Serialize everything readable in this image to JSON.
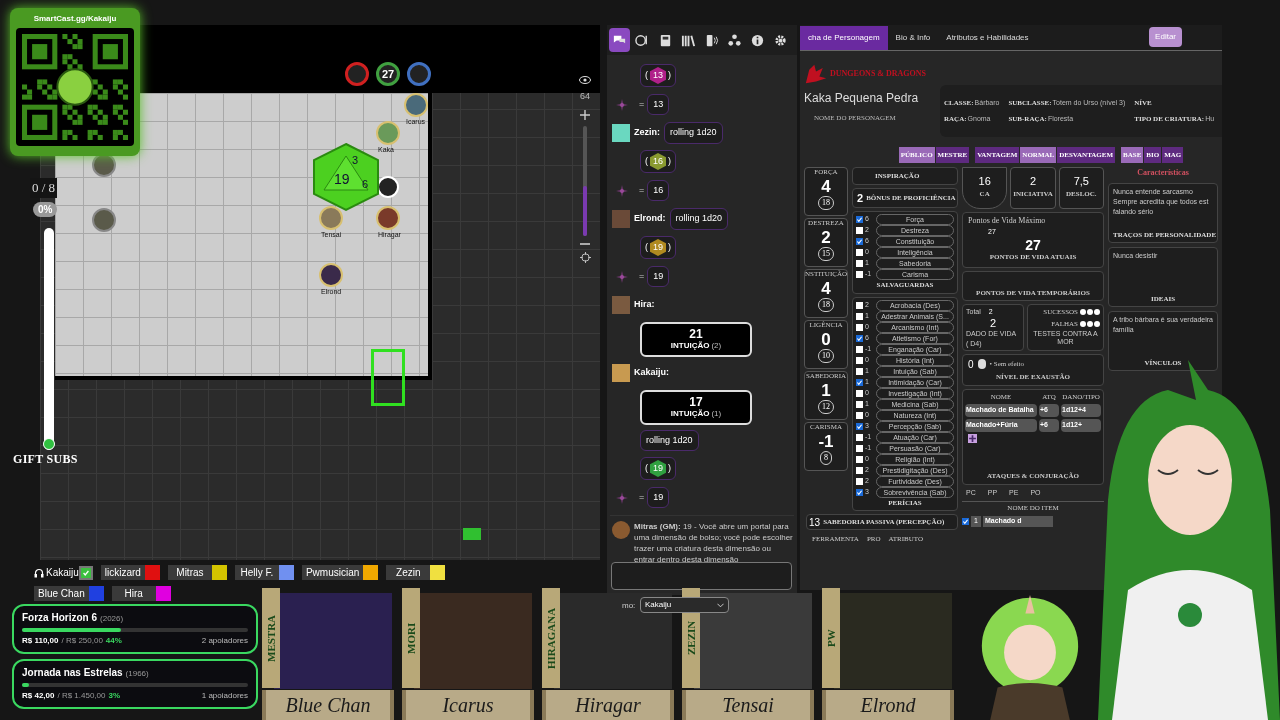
{
  "qr_card": {
    "url": "SmartCast.gg/Kakaiju"
  },
  "map": {
    "status_rings": [
      {
        "color": "#d02020"
      },
      {
        "color": "#40a040",
        "label": "27"
      },
      {
        "color": "#4070c0"
      }
    ],
    "tokens": [
      {
        "name": "Icarus"
      },
      {
        "name": "Kaka"
      },
      {
        "name": "Tensai"
      },
      {
        "name": "Hiragar"
      },
      {
        "name": "Elrond"
      }
    ],
    "dice_faces": [
      "3",
      "19",
      "6"
    ],
    "turn_counter": "0 / 8",
    "progress_label": "0%",
    "slider": {
      "level": 0
    },
    "zoom": {
      "value": "64",
      "level": 0.45
    }
  },
  "gift_subs": "GIFT SUBS",
  "chat": {
    "tabs": [
      {
        "selected": true
      },
      {
        "selected": false
      },
      {
        "selected": false
      },
      {
        "selected": false
      },
      {
        "selected": false
      },
      {
        "selected": false
      },
      {
        "selected": false
      },
      {
        "selected": false
      }
    ],
    "messages": [
      {
        "kind": "dice",
        "brackets": [
          "(",
          ")"
        ],
        "value": "13",
        "color": "#b0208a"
      },
      {
        "kind": "total",
        "sign": "=",
        "value": "13"
      },
      {
        "kind": "speaker",
        "speaker": "Zezin:",
        "text": "rolling 1d20"
      },
      {
        "kind": "dice",
        "brackets": [
          "(",
          ")"
        ],
        "value": "16",
        "color": "#8a9a30"
      },
      {
        "kind": "total",
        "sign": "=",
        "value": "16"
      },
      {
        "kind": "speaker",
        "speaker": "Elrond:",
        "text": "rolling 1d20"
      },
      {
        "kind": "dice",
        "brackets": [
          "(",
          ")"
        ],
        "value": "19",
        "color": "#b08a20"
      },
      {
        "kind": "total",
        "sign": "=",
        "value": "19"
      },
      {
        "kind": "speaker",
        "speaker": "Hira:"
      },
      {
        "kind": "card",
        "value": "21",
        "label": "INTUIÇÃO",
        "count": "(2)"
      },
      {
        "kind": "speaker",
        "speaker": "Kakaiju:"
      },
      {
        "kind": "card",
        "value": "17",
        "label": "INTUIÇÃO",
        "count": "(1)"
      },
      {
        "kind": "roll",
        "text": "rolling 1d20"
      },
      {
        "kind": "dice",
        "brackets": [
          "(",
          ")"
        ],
        "value": "19",
        "color": "#30a040"
      },
      {
        "kind": "total",
        "sign": "=",
        "value": "19"
      },
      {
        "kind": "gm",
        "text": "**Mitras (GM):** 19 - Você abre um portal para uma dimensão de bolso; você pode escolher trazer uma criatura desta dimensão ou entrar dentro desta dimensão"
      }
    ],
    "as_label": "mo:",
    "as_value": "Kakaiju"
  },
  "sheet": {
    "tabs": [
      {
        "label": "cha de Personagem",
        "selected": true
      },
      {
        "label": "Bio & Info",
        "selected": false
      },
      {
        "label": "Atributos e Habilidades",
        "selected": false
      }
    ],
    "edit_button": "Editar",
    "logo": "DUNGEONS & DRAGONS",
    "character_name": "Kaka Pequena Pedra",
    "name_label": "NOME DO PERSONAGEM",
    "info": [
      {
        "label": "CLASSE:",
        "value": "Bárbaro"
      },
      {
        "label": "SUBCLASSE:",
        "value": "Totem do Urso (nível 3)"
      },
      {
        "label": "NÍVE"
      },
      {
        "label": "RAÇA:",
        "value": "Gnoma"
      },
      {
        "label": "SUB-RAÇA:",
        "value": "Floresta"
      },
      {
        "label": "TIPO DE CRIATURA:",
        "value": "Hu"
      }
    ],
    "toggle_groups": [
      [
        {
          "label": "PÚBLICO",
          "selected": true
        },
        {
          "label": "MESTRE",
          "selected": false
        }
      ],
      [
        {
          "label": "VANTAGEM",
          "selected": false
        },
        {
          "label": "NORMAL",
          "selected": true
        },
        {
          "label": "DESVANTAGEM",
          "selected": false
        }
      ],
      [
        {
          "label": "BASE",
          "selected": true
        },
        {
          "label": "BIO",
          "selected": false
        },
        {
          "label": "MAG",
          "selected": false
        }
      ]
    ],
    "attributes": [
      {
        "label": "FORÇA",
        "modifier": "4",
        "score": "18"
      },
      {
        "label": "DESTREZA",
        "modifier": "2",
        "score": "15"
      },
      {
        "label": "NSTITUIÇÃO",
        "modifier": "4",
        "score": "18"
      },
      {
        "label": "LIGÊNCIA",
        "modifier": "0",
        "score": "10"
      },
      {
        "label": "SABEDORIA",
        "modifier": "1",
        "score": "12"
      },
      {
        "label": "CARISMA",
        "modifier": "-1",
        "score": "8"
      }
    ],
    "inspiration": "INSPIRAÇÃO",
    "proficiency": {
      "value": "2",
      "label": "BÔNUS DE PROFICIÊNCIA"
    },
    "saves": {
      "title": "SALVAGUARDAS",
      "items": [
        {
          "checked": true,
          "value": "6",
          "label": "Força"
        },
        {
          "checked": false,
          "value": "2",
          "label": "Destreza"
        },
        {
          "checked": true,
          "value": "6",
          "label": "Constituição"
        },
        {
          "checked": false,
          "value": "0",
          "label": "Inteligência"
        },
        {
          "checked": false,
          "value": "1",
          "label": "Sabedoria"
        },
        {
          "checked": false,
          "value": "-1",
          "label": "Carisma"
        }
      ]
    },
    "skills": {
      "title": "PERÍCIAS",
      "items": [
        {
          "checked": false,
          "value": "2",
          "label": "Acrobacia (Des)"
        },
        {
          "checked": false,
          "value": "1",
          "label": "Adestrar Animais (S..."
        },
        {
          "checked": false,
          "value": "0",
          "label": "Arcanismo (Int)"
        },
        {
          "checked": true,
          "value": "6",
          "label": "Atletismo (For)"
        },
        {
          "checked": false,
          "value": "-1",
          "label": "Enganação (Car)"
        },
        {
          "checked": false,
          "value": "0",
          "label": "História (Int)"
        },
        {
          "checked": false,
          "value": "1",
          "label": "Intuição (Sab)"
        },
        {
          "checked": true,
          "value": "1",
          "label": "Intimidação (Car)"
        },
        {
          "checked": false,
          "value": "0",
          "label": "Investigação (Int)"
        },
        {
          "checked": false,
          "value": "1",
          "label": "Medicina (Sab)"
        },
        {
          "checked": false,
          "value": "0",
          "label": "Natureza (Int)"
        },
        {
          "checked": true,
          "value": "3",
          "label": "Percepção (Sab)"
        },
        {
          "checked": false,
          "value": "-1",
          "label": "Atuação (Car)"
        },
        {
          "checked": false,
          "value": "-1",
          "label": "Persuasão (Car)"
        },
        {
          "checked": false,
          "value": "0",
          "label": "Religião (Int)"
        },
        {
          "checked": false,
          "value": "2",
          "label": "Prestidigitação (Des)"
        },
        {
          "checked": false,
          "value": "2",
          "label": "Furtividade (Des)"
        },
        {
          "checked": true,
          "value": "3",
          "label": "Sobrevivência (Sab)"
        }
      ]
    },
    "passive": {
      "value": "13",
      "label": "SABEDORIA PASSIVA (PERCEPÇÃO)"
    },
    "tools": {
      "columns": [
        "FERRAMENTA",
        "PRO",
        "ATRIBUTO"
      ]
    },
    "combat": [
      {
        "value": "16",
        "label": "CA"
      },
      {
        "value": "2",
        "label": "INICIATIVA"
      },
      {
        "value": "7,5",
        "label": "DESLOC."
      }
    ],
    "hp": {
      "max_label": "Pontos de Vida Máximo",
      "max": "27",
      "current": "27",
      "current_label": "PONTOS DE VIDA ATUAIS",
      "temp_label": "PONTOS DE VIDA TEMPORÁRIOS"
    },
    "hit_dice": {
      "total_label": "Total",
      "total": "2",
      "value": "2",
      "label": "DADO DE VIDA",
      "die": "( D4)"
    },
    "death_saves": {
      "successes_label": "SUCESSOS",
      "failures_label": "FALHAS",
      "label": "TESTES CONTRA A MOR"
    },
    "exhaustion": {
      "value": "0",
      "effect": "• Sem efeito",
      "label": "NÍVEL DE EXAUSTÃO"
    },
    "attacks": {
      "columns": [
        "NOME",
        "ATQ",
        "DANO/TIPO"
      ],
      "rows": [
        [
          "Machado de Batalha",
          "+6",
          "1d12+4"
        ],
        [
          "Machado+Fúria",
          "+6",
          "1d12+"
        ]
      ],
      "title": "ATAQUES & CONJURAÇÃO"
    },
    "coins": [
      "PC",
      "PP",
      "PE",
      "PO"
    ],
    "items": {
      "label": "NOME DO ITEM",
      "rows": [
        {
          "checked": true,
          "qty": "1",
          "name": "Machado d"
        }
      ]
    },
    "traits": {
      "title": "Características",
      "entries": [
        {
          "text": "Nunca entende sarcasmo Sempre acredita que todos est falando sério",
          "label": "TRAÇOS DE PERSONALIDADE"
        },
        {
          "text": "Nunca desistir",
          "label": "IDEAIS"
        },
        {
          "text": "A tribo bárbara é sua verdadeira família",
          "label": "VÍNCULOS"
        }
      ]
    }
  },
  "players": [
    {
      "kind": "self",
      "name": "Kakaiju",
      "color": "#3cc040"
    },
    {
      "kind": "player",
      "name": "lickizard",
      "color": "#e01010"
    },
    {
      "kind": "player",
      "name": "Mitras",
      "color": "#d4c400"
    },
    {
      "kind": "player",
      "name": "Helly F.",
      "color": "#7090f0"
    },
    {
      "kind": "player",
      "name": "Pwmusician",
      "color": "#f0a800"
    },
    {
      "kind": "player",
      "name": "Zezin",
      "color": "#f0e040"
    },
    {
      "kind": "player",
      "name": "Blue Chan",
      "color": "#2040e0"
    },
    {
      "kind": "player",
      "name": "Hira",
      "color": "#e000e0"
    }
  ],
  "funding": [
    {
      "title": "Forza Horizon 6",
      "year": "(2026)",
      "raised": "R$ 110,00",
      "goal": "/ R$ 250,00",
      "percent": "44%",
      "supporters": "2 apoiadores",
      "level": 0.44
    },
    {
      "title": "Jornada nas Estrelas",
      "year": "(1966)",
      "raised": "R$ 42,00",
      "goal": "/ R$ 1.450,00",
      "percent": "3%",
      "supporters": "1 apoiadores",
      "level": 0.03
    }
  ],
  "portraits": [
    {
      "tag": "MESTRA",
      "name": "Blue Chan"
    },
    {
      "tag": "MORI",
      "name": "Icarus"
    },
    {
      "tag": "HIRAGANA",
      "name": "Hiragar"
    },
    {
      "tag": "ZEZIN",
      "name": "Tensai"
    },
    {
      "tag": "PW",
      "name": "Elrond"
    }
  ]
}
